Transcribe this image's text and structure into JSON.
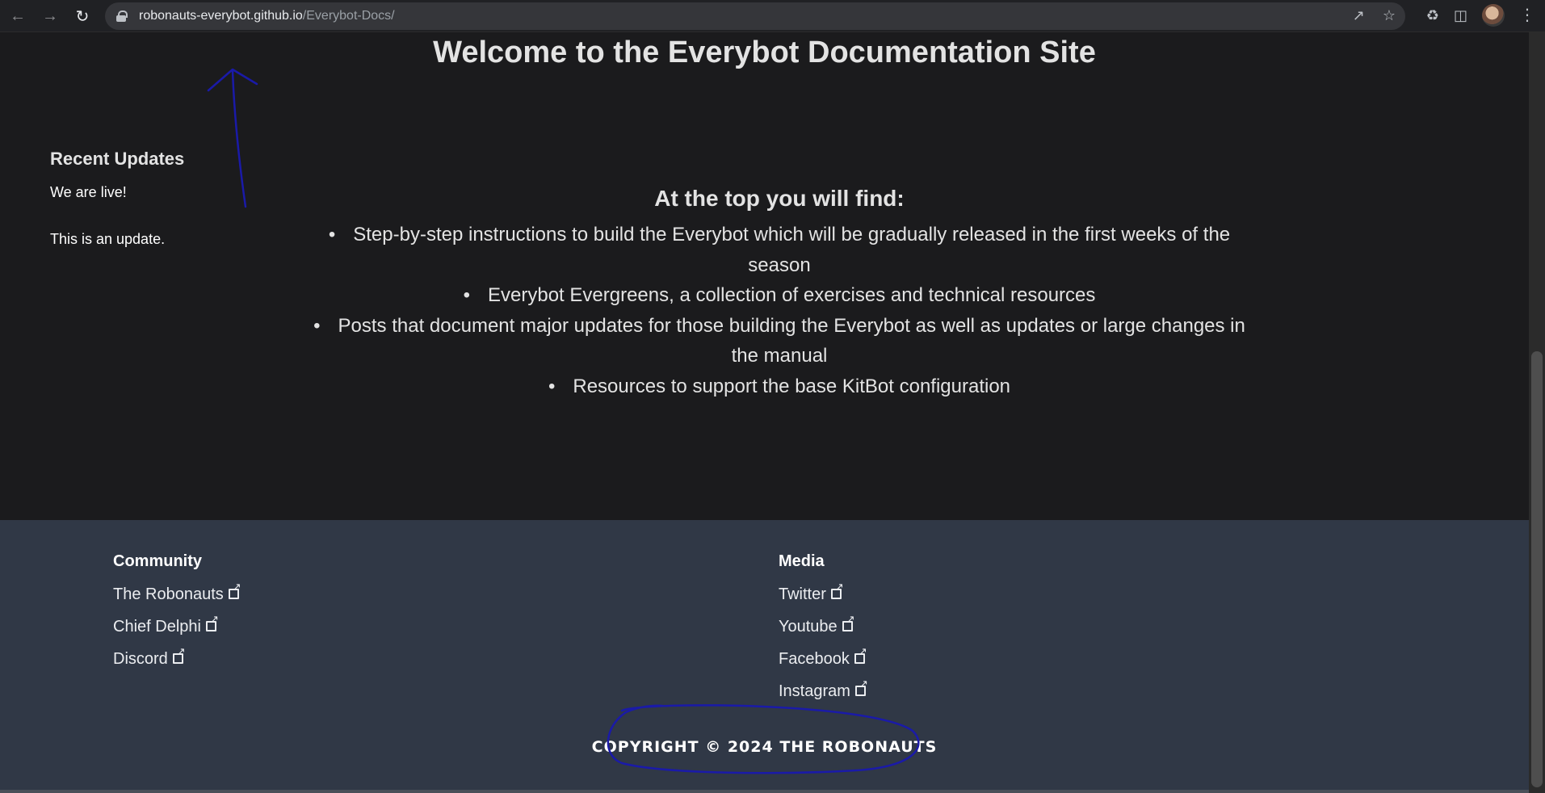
{
  "browser": {
    "url_host": "robonauts-everybot.github.io",
    "url_path": "/Everybot-Docs/"
  },
  "page": {
    "title": "Welcome to the Everybot Documentation Site"
  },
  "sidebar": {
    "heading": "Recent Updates",
    "items": [
      {
        "text": "We are live!"
      },
      {
        "text": "This is an update."
      }
    ]
  },
  "main": {
    "subheading": "At the top you will find:",
    "list": [
      {
        "text": "Step-by-step instructions to build the Everybot which will be gradually released in the first weeks of the season"
      },
      {
        "text": "Everybot Evergreens, a collection of exercises and technical resources"
      },
      {
        "text": "Posts that document major updates for those building the Everybot as well as updates or large changes in the manual"
      },
      {
        "text": "Resources to support the base KitBot configuration"
      }
    ]
  },
  "footer": {
    "community": {
      "heading": "Community",
      "links": [
        {
          "label": "The Robonauts"
        },
        {
          "label": "Chief Delphi"
        },
        {
          "label": "Discord"
        }
      ]
    },
    "media": {
      "heading": "Media",
      "links": [
        {
          "label": "Twitter"
        },
        {
          "label": "Youtube"
        },
        {
          "label": "Facebook"
        },
        {
          "label": "Instagram"
        }
      ]
    },
    "copyright": "COPYRIGHT © 2024 THE ROBONAUTS"
  },
  "colors": {
    "page_bg": "#1b1b1d",
    "footer_bg": "#303846",
    "annotation": "#1a1aa8"
  },
  "icons": [
    "back-arrow-icon",
    "forward-arrow-icon",
    "reload-icon",
    "lock-icon",
    "share-icon",
    "star-icon",
    "extensions-icon",
    "side-panel-icon",
    "kebab-menu-icon",
    "external-link-icon"
  ]
}
